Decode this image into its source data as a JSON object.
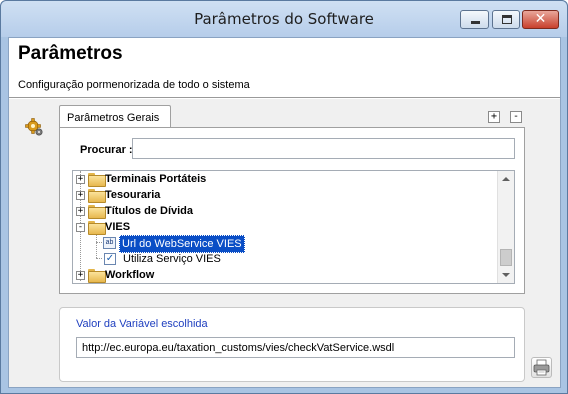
{
  "window": {
    "title": "Parâmetros do Software"
  },
  "header": {
    "title": "Parâmetros",
    "subtitle": "Configuração pormenorizada de todo o sistema"
  },
  "tabs": [
    {
      "label": "Parâmetros Gerais",
      "active": true
    }
  ],
  "tab_controls": {
    "expand": "+",
    "collapse": "-"
  },
  "search": {
    "label": "Procurar :",
    "value": ""
  },
  "tree": {
    "nodes": [
      {
        "label": "Terminais Portáteis",
        "expander": "+"
      },
      {
        "label": "Tesouraria",
        "expander": "+"
      },
      {
        "label": "Títulos de Dívida",
        "expander": "+"
      },
      {
        "label": "VIES",
        "expander": "-",
        "children": [
          {
            "label": "Url do WebService VIES",
            "icon": "text-value-icon",
            "selected": true
          },
          {
            "label": "Utiliza Serviço VIES",
            "icon": "checkbox-checked-icon",
            "checked": true
          }
        ]
      },
      {
        "label": "Workflow",
        "expander": "+"
      }
    ]
  },
  "value_panel": {
    "label": "Valor da Variável escolhida",
    "value": "http://ec.europa.eu/taxation_customs/vies/checkVatService.wsdl"
  },
  "colors": {
    "accent": "#1f3fbf",
    "selection": "#0a4ec6",
    "folder": "#e7b84e"
  }
}
